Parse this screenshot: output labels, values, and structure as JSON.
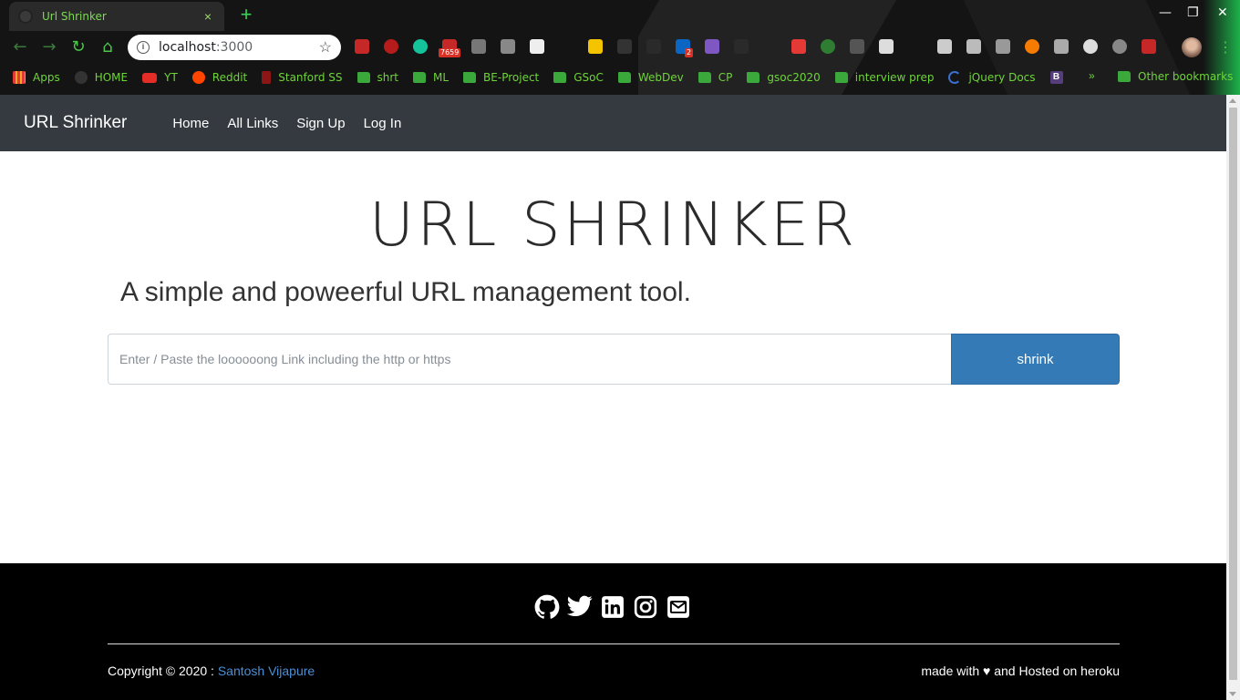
{
  "browser": {
    "tab_title": "Url Shrinker",
    "tab_close": "×",
    "new_tab": "+",
    "url_host": "localhost",
    "url_port": ":3000",
    "extension_badges": {
      "mail_count": "7659",
      "linkedin_count": "2"
    },
    "window_controls": {
      "minimize": "—",
      "restore": "❐",
      "close": "✕"
    },
    "bookmarks": [
      {
        "label": "Apps",
        "icon": "apps-grid-icon"
      },
      {
        "label": "HOME",
        "icon": "github-icon"
      },
      {
        "label": "YT",
        "icon": "youtube-icon"
      },
      {
        "label": "Reddit",
        "icon": "reddit-icon"
      },
      {
        "label": "Stanford SS",
        "icon": "stanford-icon"
      },
      {
        "label": "shrt",
        "icon": "folder-icon"
      },
      {
        "label": "ML",
        "icon": "folder-icon"
      },
      {
        "label": "BE-Project",
        "icon": "folder-icon"
      },
      {
        "label": "GSoC",
        "icon": "folder-icon"
      },
      {
        "label": "WebDev",
        "icon": "folder-icon"
      },
      {
        "label": "CP",
        "icon": "folder-icon"
      },
      {
        "label": "gsoc2020",
        "icon": "folder-icon"
      },
      {
        "label": "interview prep",
        "icon": "folder-icon"
      },
      {
        "label": "jQuery Docs",
        "icon": "jquery-icon"
      },
      {
        "label": "",
        "icon": "bootstrap-icon"
      }
    ],
    "bookmarks_more": "»",
    "other_bookmarks": "Other bookmarks",
    "accent_color": "#6fd43a"
  },
  "navbar": {
    "brand": "URL Shrinker",
    "links": [
      "Home",
      "All Links",
      "Sign Up",
      "Log In"
    ],
    "background": "#343a40"
  },
  "hero": {
    "title": "URL SHRINKER",
    "subtitle": "A simple and poweerful URL management tool."
  },
  "form": {
    "placeholder": "Enter / Paste the loooooong Link including the http or https",
    "button_label": "shrink",
    "button_color": "#337ab7"
  },
  "footer": {
    "social_icons": [
      "github-icon",
      "twitter-icon",
      "linkedin-icon",
      "instagram-icon",
      "envelope-icon"
    ],
    "copyright_prefix": "Copyright © 2020 : ",
    "author": "Santosh Vijapure",
    "made_with": "made with ♥ and Hosted on heroku"
  }
}
